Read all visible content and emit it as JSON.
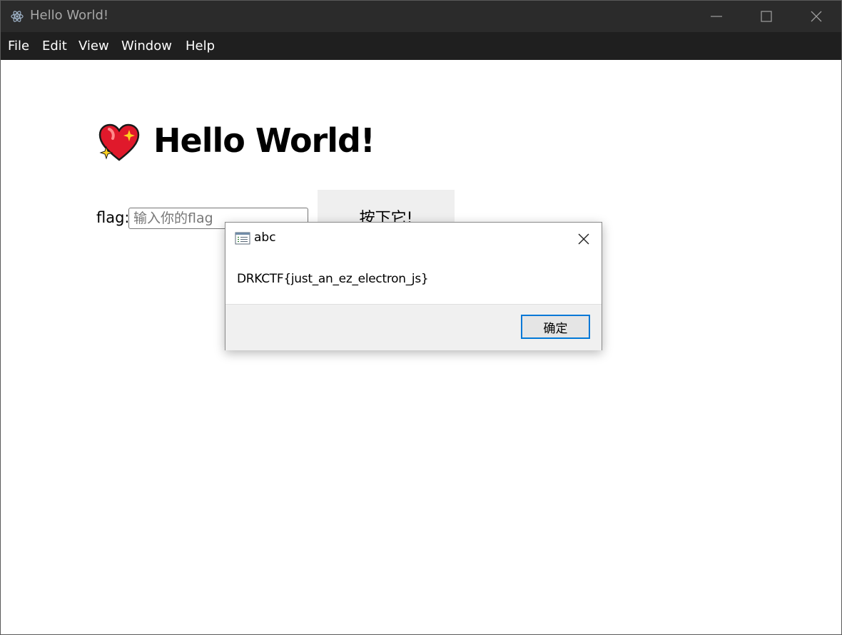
{
  "window": {
    "title": "Hello World!",
    "app_icon": "electron-icon",
    "controls": [
      "minimize-icon",
      "maximize-icon",
      "close-icon"
    ]
  },
  "menu": {
    "items": [
      {
        "label": "File"
      },
      {
        "label": "Edit"
      },
      {
        "label": "View"
      },
      {
        "label": "Window"
      },
      {
        "label": "Help"
      }
    ]
  },
  "page": {
    "heading_icon": "sparkling-heart-icon",
    "heading": "Hello World!",
    "flag_label": "flag:",
    "flag_input": {
      "value": "",
      "placeholder": "输入你的flag"
    },
    "submit_label": "按下它!"
  },
  "dialog": {
    "icon": "window-list-icon",
    "title": "abc",
    "message": "DRKCTF{just_an_ez_electron_js}",
    "ok_label": "确定",
    "accent": "#0078d7"
  }
}
